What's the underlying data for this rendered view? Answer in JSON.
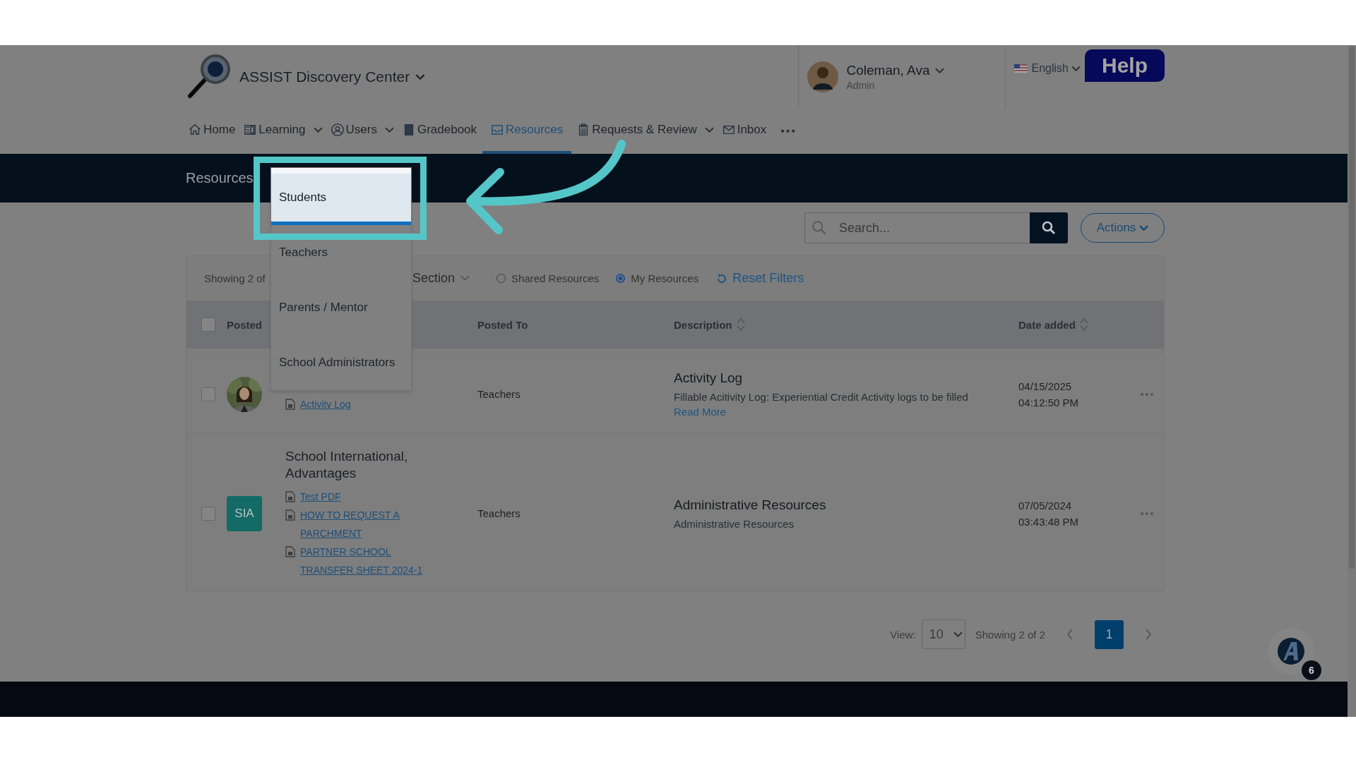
{
  "header": {
    "app_title": "ASSIST Discovery Center",
    "user": {
      "name": "Coleman, Ava",
      "role": "Admin"
    },
    "language": "English",
    "help": "Help"
  },
  "nav": [
    {
      "label": "Home",
      "selected": false,
      "dropdown": false
    },
    {
      "label": "Learning",
      "selected": false,
      "dropdown": true
    },
    {
      "label": "Users",
      "selected": false,
      "dropdown": true
    },
    {
      "label": "Gradebook",
      "selected": false,
      "dropdown": false
    },
    {
      "label": "Resources",
      "selected": true,
      "dropdown": false
    },
    {
      "label": "Requests & Review",
      "selected": false,
      "dropdown": true
    },
    {
      "label": "Inbox",
      "selected": false,
      "dropdown": false
    }
  ],
  "nav_more": "•••",
  "page_title": "Resources",
  "search": {
    "placeholder": "Search..."
  },
  "actions": "Actions",
  "filters": {
    "showing": "Showing 2 of",
    "section": "Section",
    "radios": [
      {
        "label": "Shared Resources",
        "selected": false
      },
      {
        "label": "My Resources",
        "selected": true
      }
    ],
    "reset": "Reset Filters"
  },
  "posted_to_menu": [
    {
      "label": "Students",
      "selected": true
    },
    {
      "label": "Teachers",
      "selected": false
    },
    {
      "label": "Parents / Mentor",
      "selected": false
    },
    {
      "label": "School Administrators",
      "selected": false
    }
  ],
  "table": {
    "header_checked": false,
    "columns": [
      {
        "label": "Posted",
        "sortable": false
      },
      {
        "label": "Posted To",
        "sortable": false
      },
      {
        "label": "Description",
        "sortable": true
      },
      {
        "label": "Date added",
        "sortable": true
      }
    ],
    "rows": [
      {
        "checked": false,
        "avatar": {
          "kind": "picture"
        },
        "files": [
          "Activity Log"
        ],
        "posted_to": "Teachers",
        "title": "Activity Log",
        "description": "Fillable Acitivity Log: Experiential Credit Activity logs to be filled",
        "read_more": "Read More",
        "date": "04/15/2025",
        "time": "04:12:50 PM",
        "menu": "•••"
      },
      {
        "checked": false,
        "avatar": {
          "kind": "initials",
          "text": "SIA"
        },
        "name": "School International, Advantages",
        "files": [
          "Test PDF",
          "HOW TO REQUEST A PARCHMENT",
          "PARTNER SCHOOL TRANSFER SHEET 2024-1"
        ],
        "posted_to": "Teachers",
        "title": "Administrative Resources",
        "description": "Administrative Resources",
        "date": "07/05/2024",
        "time": "03:43:48 PM",
        "menu": "•••"
      }
    ]
  },
  "pagination": {
    "view_label": "View:",
    "page_size": "10",
    "showing": "Showing 2 of 2",
    "pages": [
      {
        "label": "1",
        "selected": true
      }
    ]
  },
  "chat": {
    "badge": "6"
  }
}
